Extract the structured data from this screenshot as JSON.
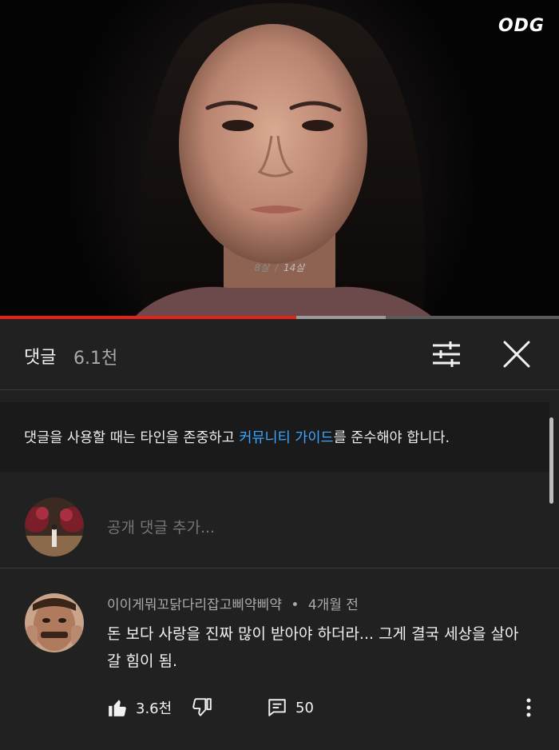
{
  "video": {
    "watermark": "ODG",
    "caption_left": "8살",
    "caption_sep": "/",
    "caption_right": "14살",
    "progress_played": 0.53,
    "progress_buffered": 0.69
  },
  "comments_header": {
    "title": "댓글",
    "count": "6.1천",
    "filter_icon": "sort-sliders-icon",
    "close_icon": "close-icon"
  },
  "guidelines": {
    "text_before": "댓글을 사용할 때는 타인을 존중하고 ",
    "link_text": "커뮤니티 가이드",
    "text_after": "를 준수해야 합니다."
  },
  "add_comment": {
    "placeholder": "공개 댓글 추가..."
  },
  "comments": [
    {
      "author": "이이게뭐꼬닭다리잡고삐약삐약",
      "separator": "•",
      "time": "4개월 전",
      "text": "돈 보다 사랑을 진짜 많이 받아야 하더라... 그게 결국 세상을 살아갈 힘이 됨.",
      "likes": "3.6천",
      "replies": "50"
    }
  ],
  "colors": {
    "background": "#212121",
    "banner": "#1a1a1a",
    "link": "#3ea6ff",
    "progress": "#e62117",
    "secondary_text": "#aaaaaa"
  }
}
